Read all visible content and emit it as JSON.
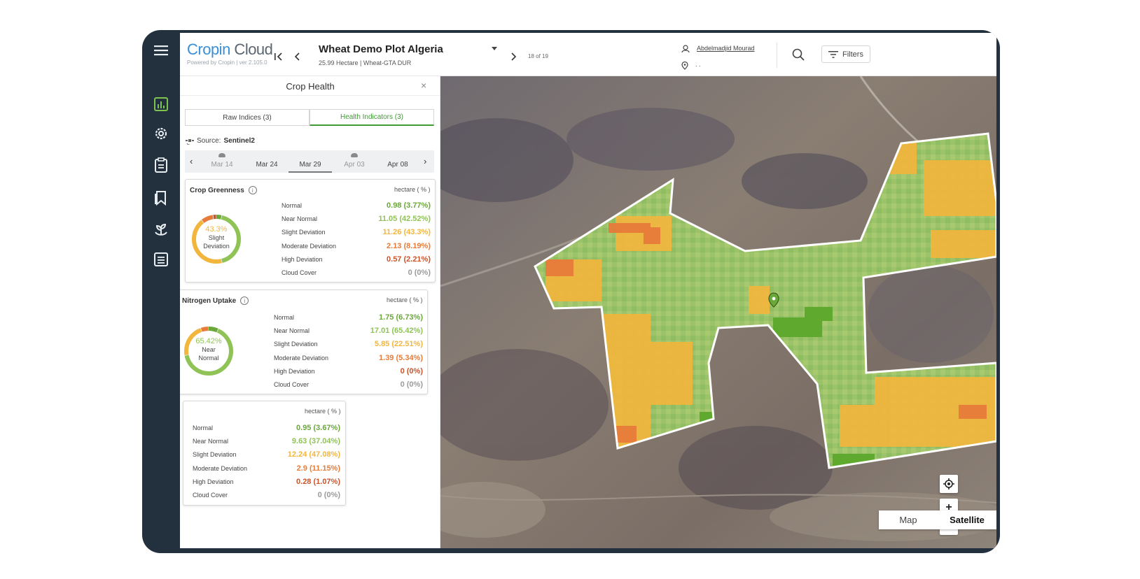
{
  "app": {
    "logo_part1": "Cropin",
    "logo_part2": " Cloud",
    "powered_by": "Powered by Cropin",
    "version": "ver 2.105.0"
  },
  "rail": {
    "icons": [
      "menu-icon",
      "analytics-icon",
      "settings-icon",
      "clipboard-icon",
      "bookmark-icon",
      "plant-icon",
      "list-icon"
    ]
  },
  "plot": {
    "name": "Wheat Demo Plot Algeria",
    "details": "25.99 Hectare | Wheat-GTA DUR",
    "position": "18 of 19"
  },
  "user": {
    "name": "Abdelmadjid Mourad",
    "location": ". ."
  },
  "toolbar": {
    "filters_label": "Filters"
  },
  "panel": {
    "title": "Crop Health",
    "close_glyph": "×",
    "tabs": [
      {
        "label": "Raw Indices (3)",
        "active": false
      },
      {
        "label": "Health Indicators (3)",
        "active": true
      }
    ],
    "source_label": "Source:",
    "source_value": "Sentinel2",
    "dates": [
      {
        "label": "Mar 14",
        "cloudy": true
      },
      {
        "label": "Mar 24",
        "cloudy": false
      },
      {
        "label": "Mar 29",
        "cloudy": false,
        "active": true
      },
      {
        "label": "Apr 03",
        "cloudy": true
      },
      {
        "label": "Apr 08",
        "cloudy": false
      }
    ]
  },
  "colors": {
    "normal": "#6aa83a",
    "near_normal": "#8fc356",
    "slight_deviation": "#f2b63d",
    "moderate_deviation": "#e77b3a",
    "high_deviation": "#c9542a",
    "cloud_cover": "#9b9b9b",
    "accent": "#3f9b34"
  },
  "indicators": [
    {
      "title": "Crop Greenness",
      "unit": "hectare ( % )",
      "donut_pct": "43.3%",
      "donut_label_1": "Slight",
      "donut_label_2": "Deviation",
      "donut_color": "#f2b63d",
      "rows": [
        {
          "label": "Normal",
          "value": "0.98 (3.77%)",
          "fraction": 0.0377,
          "color": "#6aa83a"
        },
        {
          "label": "Near Normal",
          "value": "11.05 (42.52%)",
          "fraction": 0.4252,
          "color": "#8fc356"
        },
        {
          "label": "Slight Deviation",
          "value": "11.26 (43.3%)",
          "fraction": 0.433,
          "color": "#f2b63d"
        },
        {
          "label": "Moderate Deviation",
          "value": "2.13 (8.19%)",
          "fraction": 0.0819,
          "color": "#e77b3a"
        },
        {
          "label": "High Deviation",
          "value": "0.57 (2.21%)",
          "fraction": 0.0221,
          "color": "#c9542a"
        },
        {
          "label": "Cloud Cover",
          "value": "0 (0%)",
          "fraction": 0,
          "color": "#9b9b9b"
        }
      ]
    },
    {
      "title": "Nitrogen Uptake",
      "unit": "hectare ( % )",
      "donut_pct": "65.42%",
      "donut_label_1": "Near",
      "donut_label_2": "Normal",
      "donut_color": "#8fc356",
      "rows": [
        {
          "label": "Normal",
          "value": "1.75 (6.73%)",
          "fraction": 0.0673,
          "color": "#6aa83a"
        },
        {
          "label": "Near Normal",
          "value": "17.01 (65.42%)",
          "fraction": 0.6542,
          "color": "#8fc356"
        },
        {
          "label": "Slight Deviation",
          "value": "5.85 (22.51%)",
          "fraction": 0.2251,
          "color": "#f2b63d"
        },
        {
          "label": "Moderate Deviation",
          "value": "1.39 (5.34%)",
          "fraction": 0.0534,
          "color": "#e77b3a"
        },
        {
          "label": "High Deviation",
          "value": "0 (0%)",
          "fraction": 0,
          "color": "#c9542a"
        },
        {
          "label": "Cloud Cover",
          "value": "0 (0%)",
          "fraction": 0,
          "color": "#9b9b9b"
        }
      ]
    },
    {
      "title": "",
      "unit": "hectare ( % )",
      "rows": [
        {
          "label": "Normal",
          "value": "0.95 (3.67%)",
          "fraction": 0.0367,
          "color": "#6aa83a"
        },
        {
          "label": "Near Normal",
          "value": "9.63 (37.04%)",
          "fraction": 0.3704,
          "color": "#8fc356"
        },
        {
          "label": "Slight Deviation",
          "value": "12.24 (47.08%)",
          "fraction": 0.4708,
          "color": "#f2b63d"
        },
        {
          "label": "Moderate Deviation",
          "value": "2.9 (11.15%)",
          "fraction": 0.1115,
          "color": "#e77b3a"
        },
        {
          "label": "High Deviation",
          "value": "0.28 (1.07%)",
          "fraction": 0.0107,
          "color": "#c9542a"
        },
        {
          "label": "Cloud Cover",
          "value": "0 (0%)",
          "fraction": 0,
          "color": "#9b9b9b"
        }
      ]
    }
  ],
  "map": {
    "zoom_in": "+",
    "zoom_out": "-",
    "view_options": [
      {
        "label": "Map",
        "selected": false
      },
      {
        "label": "Satellite",
        "selected": true
      }
    ]
  }
}
